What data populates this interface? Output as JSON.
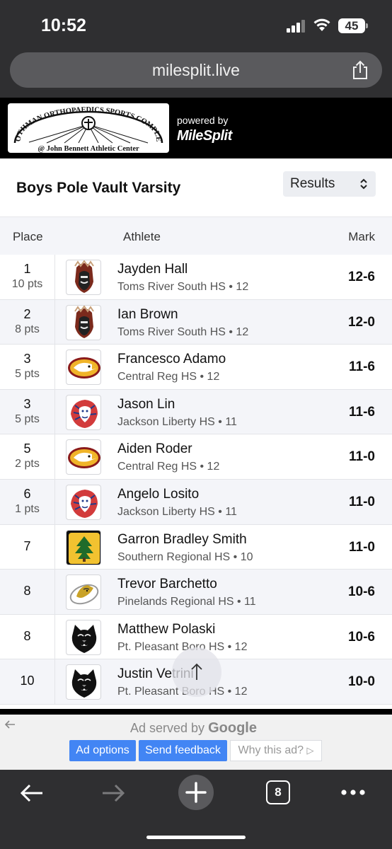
{
  "status": {
    "time": "10:52",
    "battery": "45"
  },
  "browser": {
    "url": "milesplit.live",
    "tab_count": "8"
  },
  "banner": {
    "sponsor_line1": "ROTHMAN ORTHOPAEDICS SPORTS COMPLEX",
    "sponsor_line2": "@ John Bennett Athletic Center",
    "powered_by": "powered by",
    "brand": "MileSplit"
  },
  "event": {
    "title": "Boys Pole Vault Varsity",
    "view_select": "Results"
  },
  "table": {
    "headers": {
      "place": "Place",
      "athlete": "Athlete",
      "mark": "Mark"
    },
    "rows": [
      {
        "place": "1",
        "pts": "10 pts",
        "name": "Jayden Hall",
        "school": "Toms River South HS • 12",
        "mark": "12-6",
        "logo": "indians"
      },
      {
        "place": "2",
        "pts": "8 pts",
        "name": "Ian Brown",
        "school": "Toms River South HS • 12",
        "mark": "12-0",
        "logo": "indians"
      },
      {
        "place": "3",
        "pts": "5 pts",
        "name": "Francesco Adamo",
        "school": "Central Reg HS • 12",
        "mark": "11-6",
        "logo": "golden-eagle"
      },
      {
        "place": "3",
        "pts": "5 pts",
        "name": "Jason Lin",
        "school": "Jackson Liberty HS • 11",
        "mark": "11-6",
        "logo": "lion"
      },
      {
        "place": "5",
        "pts": "2 pts",
        "name": "Aiden Roder",
        "school": "Central Reg HS • 12",
        "mark": "11-0",
        "logo": "golden-eagle"
      },
      {
        "place": "6",
        "pts": "1 pts",
        "name": "Angelo Losito",
        "school": "Jackson Liberty HS • 11",
        "mark": "11-0",
        "logo": "lion"
      },
      {
        "place": "7",
        "pts": "",
        "name": "Garron Bradley Smith",
        "school": "Southern Regional HS • 10",
        "mark": "11-0",
        "logo": "tree-s"
      },
      {
        "place": "8",
        "pts": "",
        "name": "Trevor Barchetto",
        "school": "Pinelands Regional HS • 11",
        "mark": "10-6",
        "logo": "wildcat"
      },
      {
        "place": "8",
        "pts": "",
        "name": "Matthew Polaski",
        "school": "Pt. Pleasant Boro HS • 12",
        "mark": "10-6",
        "logo": "panther"
      },
      {
        "place": "10",
        "pts": "",
        "name": "Justin Vetrini",
        "school": "Pt. Pleasant Boro HS • 12",
        "mark": "10-0",
        "logo": "panther"
      }
    ]
  },
  "ad": {
    "served_by": "Ad served by",
    "google": "Google",
    "options": "Ad options",
    "feedback": "Send feedback",
    "why": "Why this ad?"
  },
  "colors": {
    "accent_blue": "#4285f4",
    "chrome": "#2f2f31",
    "row_alt": "#f4f5f9"
  }
}
